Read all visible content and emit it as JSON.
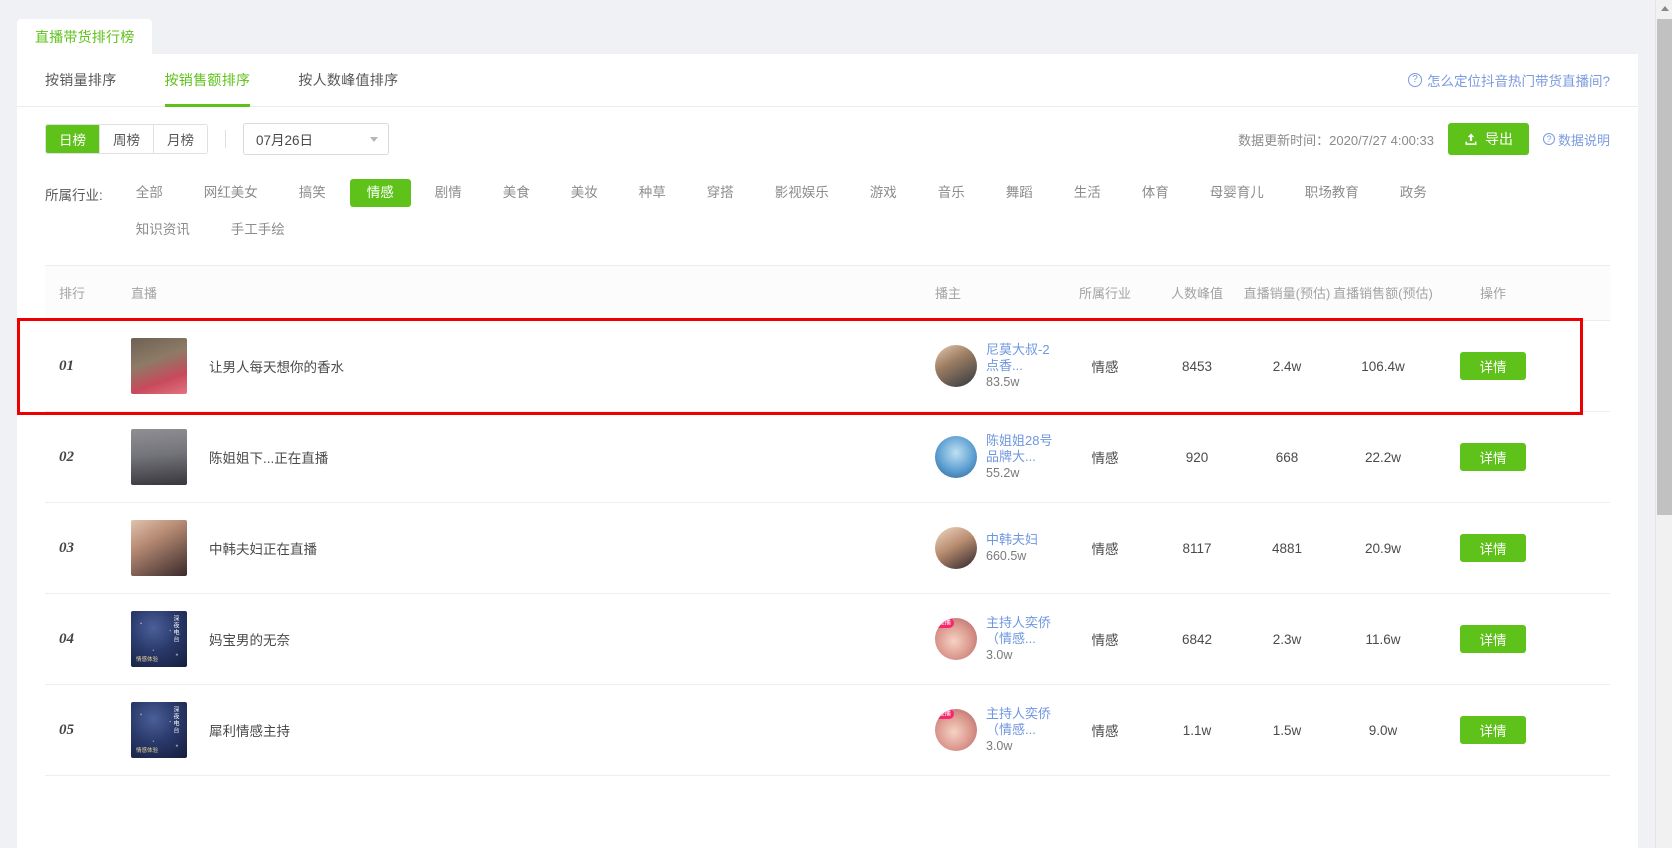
{
  "top_tab": {
    "label": "直播带货排行榜"
  },
  "sort_tabs": [
    {
      "label": "按销量排序",
      "active": false
    },
    {
      "label": "按销售额排序",
      "active": true
    },
    {
      "label": "按人数峰值排序",
      "active": false
    }
  ],
  "help_link": {
    "icon": "question-circle-icon",
    "label": "怎么定位抖音热门带货直播间?"
  },
  "period": {
    "options": [
      "日榜",
      "周榜",
      "月榜"
    ],
    "selected": "日榜"
  },
  "date_select": {
    "value": "07月26日",
    "icon": "chevron-down-icon"
  },
  "updated": {
    "text": "数据更新时间：2020/7/27 4:00:33",
    "export_label": "导出",
    "export_icon": "upload-icon",
    "data_desc_label": "数据说明",
    "data_desc_icon": "question-circle-icon"
  },
  "industry": {
    "label": "所属行业:",
    "tags": [
      "全部",
      "网红美女",
      "搞笑",
      "情感",
      "剧情",
      "美食",
      "美妆",
      "种草",
      "穿搭",
      "影视娱乐",
      "游戏",
      "音乐",
      "舞蹈",
      "生活",
      "体育",
      "母婴育儿",
      "职场教育",
      "政务",
      "知识资讯",
      "手工手绘"
    ],
    "selected": "情感"
  },
  "table": {
    "headers": {
      "rank": "排行",
      "live": "直播",
      "host": "播主",
      "industry": "所属行业",
      "peak": "人数峰值",
      "sales": "直播销量(预估)",
      "amount": "直播销售额(预估)",
      "operation": "操作"
    },
    "detail_label": "详情",
    "rows": [
      {
        "rank": "01",
        "title": "让男人每天想你的香水",
        "host_name": "尼莫大叔-2点香...",
        "host_fans": "83.5w",
        "live_badge": "",
        "industry": "情感",
        "peak": "8453",
        "sales": "2.4w",
        "amount": "106.4w",
        "highlighted": true
      },
      {
        "rank": "02",
        "title": "陈姐姐下...正在直播",
        "host_name": "陈姐姐28号品牌大...",
        "host_fans": "55.2w",
        "live_badge": "",
        "industry": "情感",
        "peak": "920",
        "sales": "668",
        "amount": "22.2w",
        "highlighted": false
      },
      {
        "rank": "03",
        "title": "中韩夫妇正在直播",
        "host_name": "中韩夫妇",
        "host_fans": "660.5w",
        "live_badge": "",
        "industry": "情感",
        "peak": "8117",
        "sales": "4881",
        "amount": "20.9w",
        "highlighted": false
      },
      {
        "rank": "04",
        "title": "妈宝男的无奈",
        "host_name": "主持人奕侨（情感...",
        "host_fans": "3.0w",
        "live_badge": "直播",
        "industry": "情感",
        "peak": "6842",
        "sales": "2.3w",
        "amount": "11.6w",
        "highlighted": false
      },
      {
        "rank": "05",
        "title": "犀利情感主持",
        "host_name": "主持人奕侨（情感...",
        "host_fans": "3.0w",
        "live_badge": "直播",
        "industry": "情感",
        "peak": "1.1w",
        "sales": "1.5w",
        "amount": "9.0w",
        "highlighted": false
      }
    ]
  },
  "radio_art": {
    "vertical": "深夜电台",
    "mark": "「M」",
    "bottom": "情感体验"
  },
  "colors": {
    "accent": "#5fc21a",
    "link": "#7b9ae0",
    "highlight": "#ee0000",
    "badge": "#f5286e"
  }
}
